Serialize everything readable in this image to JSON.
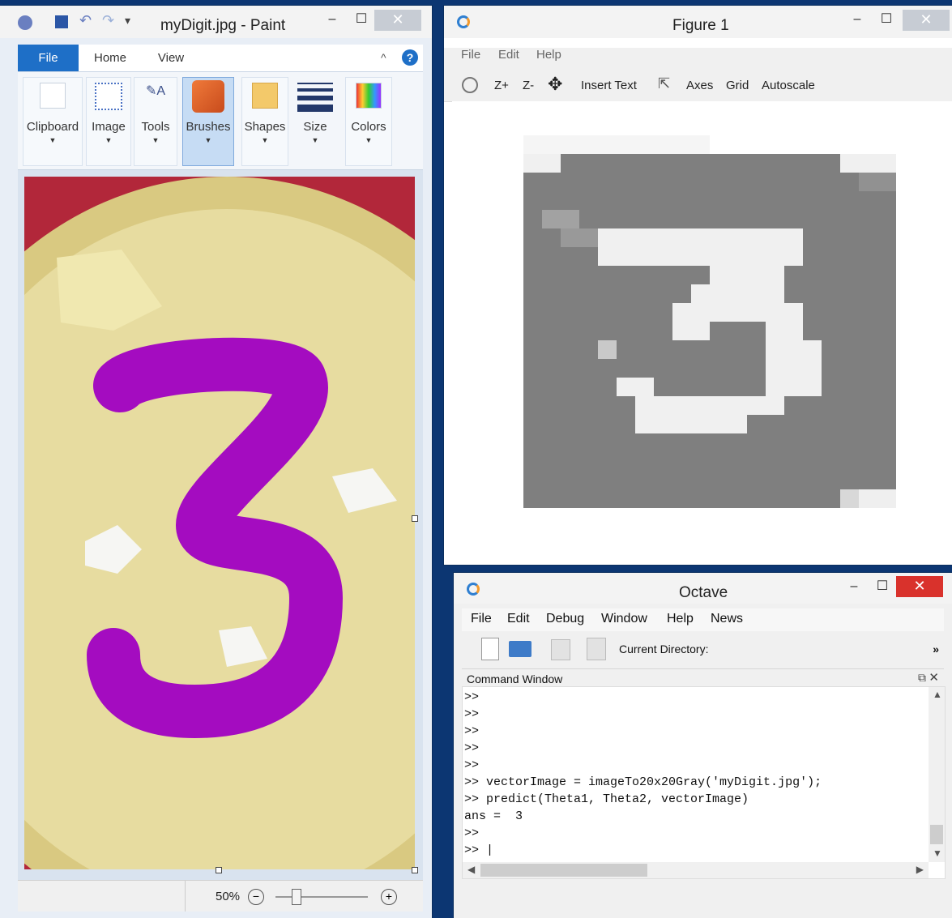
{
  "paint": {
    "title": "myDigit.jpg - Paint",
    "tabs": [
      "File",
      "Home",
      "View"
    ],
    "groups": [
      "Clipboard",
      "Image",
      "Tools",
      "Brushes",
      "Shapes",
      "Size",
      "Colors"
    ],
    "zoom": "50%",
    "canvas_digit": "3"
  },
  "figure": {
    "title": "Figure 1",
    "menu": [
      "File",
      "Edit",
      "Help"
    ],
    "toolbar": {
      "zoom_in": "Z+",
      "zoom_out": "Z-",
      "insert_text": "Insert Text",
      "axes": "Axes",
      "grid": "Grid",
      "autoscale": "Autoscale"
    }
  },
  "octave": {
    "title": "Octave",
    "menu": [
      "File",
      "Edit",
      "Debug",
      "Window",
      "Help",
      "News"
    ],
    "current_directory_label": "Current Directory:",
    "more": "»",
    "command_window_label": "Command Window",
    "lines": [
      ">>",
      ">>",
      ">>",
      ">>",
      ">>",
      ">> vectorImage = imageTo20x20Gray('myDigit.jpg');",
      ">> predict(Theta1, Theta2, vectorImage)",
      "ans =  3",
      ">>",
      ">> |"
    ]
  },
  "colors": {
    "desktop": "#0c3672",
    "close_red": "#d9322c",
    "brush_purple": "#a40cc0",
    "plate": "#e7dca0",
    "table_red": "#b2273a"
  }
}
